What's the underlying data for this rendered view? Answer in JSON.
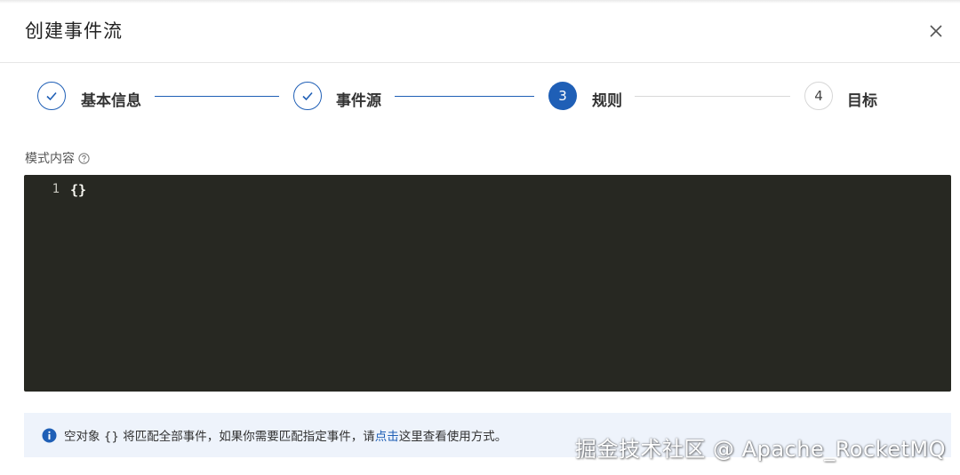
{
  "dialog": {
    "title": "创建事件流"
  },
  "steps": [
    {
      "number": "",
      "label": "基本信息",
      "status": "done"
    },
    {
      "number": "",
      "label": "事件源",
      "status": "done"
    },
    {
      "number": "3",
      "label": "规则",
      "status": "active"
    },
    {
      "number": "4",
      "label": "目标",
      "status": "todo"
    }
  ],
  "pattern": {
    "label": "模式内容",
    "line_numbers": [
      "1"
    ],
    "code": "{}"
  },
  "notice": {
    "text_before": "空对象 {} 将匹配全部事件，如果你需要匹配指定事件，请",
    "link": "点击",
    "text_after": "这里查看使用方式。"
  },
  "watermark": "掘金技术社区 @ Apache_RocketMQ",
  "colors": {
    "primary": "#1f5fb6",
    "editor_bg": "#272822",
    "notice_bg": "#eef3fb"
  }
}
